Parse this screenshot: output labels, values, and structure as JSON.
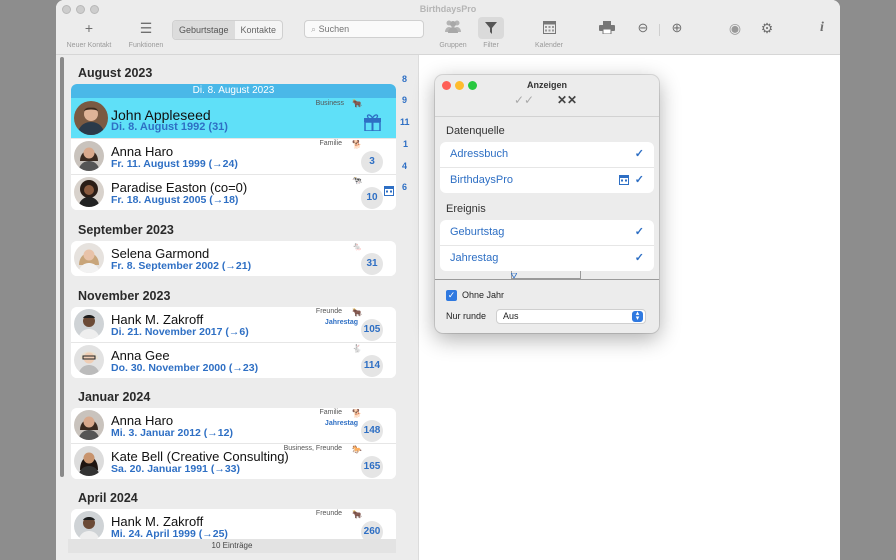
{
  "window": {
    "title": "BirthdaysPro"
  },
  "toolbar": {
    "new_contact": "Neuer Kontakt",
    "functions": "Funktionen",
    "segments": [
      "Geburtstage",
      "Kontakte"
    ],
    "search_placeholder": "Suchen",
    "groups": "Gruppen",
    "filter": "Filter",
    "calendar": "Kalender"
  },
  "list": {
    "months": [
      "August 2023",
      "September 2023",
      "November 2023",
      "Januar 2024",
      "April 2024"
    ],
    "highlight_header": "Di. 8. August 2023",
    "entries": [
      {
        "name": "John Appleseed",
        "date": "Di. 8. August 1992 (31)",
        "tag": "Business"
      },
      {
        "name": "Anna Haro",
        "date": "Fr. 11. August 1999 (→24)",
        "tag": "Familie",
        "badge": "3"
      },
      {
        "name": "Paradise Easton (co=0)",
        "date": "Fr. 18. August 2005 (→18)",
        "tag": "",
        "badge": "10"
      },
      {
        "name": "Selena Garmond",
        "date": "Fr. 8. September 2002 (→21)",
        "tag": "",
        "badge": "31"
      },
      {
        "name": "Hank M. Zakroff",
        "date": "Di. 21. November 2017 (→6)",
        "tag": "Freunde",
        "tag2": "Jahrestag",
        "badge": "105"
      },
      {
        "name": "Anna Gee",
        "date": "Do. 30. November 2000 (→23)",
        "tag": "",
        "badge": "114"
      },
      {
        "name": "Anna Haro",
        "date": "Mi. 3. Januar 2012 (→12)",
        "tag": "Familie",
        "tag2": "Jahrestag",
        "badge": "148"
      },
      {
        "name": "Kate Bell (Creative Consulting)",
        "date": "Sa. 20. Januar 1991 (→33)",
        "tag": "Business, Freunde",
        "badge": "165"
      },
      {
        "name": "Hank M. Zakroff",
        "date": "Mi. 24. April 1999 (→25)",
        "tag": "Freunde",
        "badge": "260"
      }
    ],
    "index": [
      "8",
      "9",
      "11",
      "1",
      "4",
      "6"
    ],
    "footer": "10 Einträge"
  },
  "panel": {
    "title": "Anzeigen",
    "select_all": "✓✓",
    "deselect_all": "✕✕",
    "source_heading": "Datenquelle",
    "sources": [
      "Adressbuch",
      "BirthdaysPro"
    ],
    "event_heading": "Ereignis",
    "events": [
      "Geburtstag",
      "Jahrestag"
    ],
    "check": "✓",
    "no_year_label": "Ohne Jahr",
    "round_label": "Nur runde",
    "round_value": "Aus"
  },
  "colors": {
    "accent": "#2e6fc4",
    "highlight": "#5fe0f8",
    "highlight_header": "#4ab8e8"
  },
  "icons": [
    "plus-icon",
    "menu-icon",
    "search-icon",
    "groups-icon",
    "filter-icon",
    "calendar-icon",
    "printer-icon",
    "zoom-out-icon",
    "zoom-in-icon",
    "eye-icon",
    "gear-icon",
    "info-icon",
    "gift-icon",
    "animal-icon"
  ]
}
